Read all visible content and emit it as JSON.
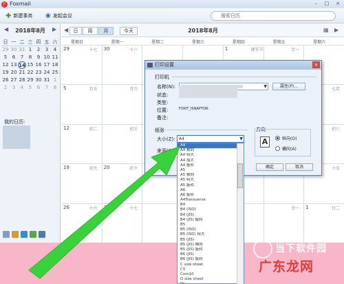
{
  "app": {
    "title": "Foxmail",
    "logo": "F"
  },
  "toolbar": {
    "new_task": "新建事务",
    "meeting": "发起会议"
  },
  "search": {
    "placeholder": "搜索日历"
  },
  "mini_calendar": {
    "title": "2018年8月",
    "weekdays": [
      "日",
      "一",
      "二",
      "三",
      "四",
      "五",
      "六"
    ],
    "days": [
      [
        "29",
        "30",
        "31",
        "1",
        "2",
        "3",
        "4"
      ],
      [
        "5",
        "6",
        "7",
        "8",
        "9",
        "10",
        "11"
      ],
      [
        "12",
        "13",
        "14",
        "15",
        "16",
        "17",
        "18"
      ],
      [
        "19",
        "20",
        "21",
        "22",
        "23",
        "24",
        "25"
      ],
      [
        "26",
        "27",
        "28",
        "29",
        "30",
        "31",
        "1"
      ],
      [
        "2",
        "3",
        "4",
        "5",
        "6",
        "7",
        "8"
      ]
    ],
    "today": "14"
  },
  "my_calendar_label": "我的日历:",
  "view": {
    "day": "日",
    "week": "周",
    "month": "月",
    "today": "今天",
    "title": "2018年8月"
  },
  "weekdays_full": [
    "星期日",
    "星期一",
    "星期二",
    "星期三",
    "星期四",
    "星期五",
    "星期六"
  ],
  "grid": [
    [
      {
        "d": "29",
        "l": "十七"
      },
      {
        "d": "30",
        "l": "十八"
      },
      {
        "d": "",
        "l": ""
      },
      {
        "d": "",
        "l": ""
      },
      {
        "d": "1",
        "l": "建军节"
      },
      {
        "d": "",
        "l": "廿一"
      },
      {
        "d": "",
        "l": ""
      }
    ],
    [
      {
        "d": "5",
        "l": "廿五"
      },
      {
        "d": "",
        "l": "廿六"
      },
      {
        "d": "",
        "l": ""
      },
      {
        "d": "",
        "l": ""
      },
      {
        "d": "",
        "l": ""
      },
      {
        "d": "",
        "l": "廿九"
      },
      {
        "d": "",
        "l": "七月"
      }
    ],
    [
      {
        "d": "12",
        "l": "初二"
      },
      {
        "d": "",
        "l": "初三"
      },
      {
        "d": "",
        "l": ""
      },
      {
        "d": "",
        "l": ""
      },
      {
        "d": "",
        "l": ""
      },
      {
        "d": "",
        "l": "初七"
      },
      {
        "d": "",
        "l": "初八"
      }
    ],
    [
      {
        "d": "19",
        "l": "初九"
      },
      {
        "d": "20",
        "l": "初十"
      },
      {
        "d": "",
        "l": ""
      },
      {
        "d": "",
        "l": ""
      },
      {
        "d": "",
        "l": ""
      },
      {
        "d": "",
        "l": "十四"
      },
      {
        "d": "25",
        "l": "十五"
      }
    ],
    [
      {
        "d": "26",
        "l": "十六"
      },
      {
        "d": "27",
        "l": "十七"
      },
      {
        "d": "",
        "l": ""
      },
      {
        "d": "",
        "l": ""
      },
      {
        "d": "",
        "l": ""
      },
      {
        "d": "",
        "l": "廿一"
      },
      {
        "d": "1",
        "l": "廿二"
      }
    ]
  ],
  "dialog": {
    "title": "打印设置",
    "printer_group": "打印机",
    "name_label": "名称(N):",
    "properties_button": "属性(P)...",
    "status_label": "状态:",
    "type_label": "类型:",
    "where_label": "位置:",
    "where_value": "FOXIT_ISNAPTOR:",
    "comment_label": "备注:",
    "paper_group": "纸张",
    "size_label": "大小(Z):",
    "size_value": "A4",
    "source_label": "来源(S)",
    "orientation_group": "方向",
    "portrait_label": "纵向(O)",
    "landscape_label": "横向(A)",
    "ok_button": "确定",
    "cancel_button": "取消",
    "paper_sizes": [
      "A4",
      "A4 横向",
      "A4 特大",
      "A4 加大",
      "A4 旋转",
      "A5",
      "A5 横向",
      "A5 特大",
      "A5 旋转",
      "A6",
      "A6 旋转",
      "A4Transverse",
      "B4",
      "B4 (ISO)",
      "B4 (JIS)",
      "B4 (JIS) 旋转",
      "B5",
      "B5 (ISO)",
      "B5 (ISO) 特大",
      "B5 (JIS)",
      "B5 (JIS) 横向",
      "B5 (JIS) 旋转",
      "B6 (JIS)",
      "B6 (JIS) 旋转",
      "C size sheet",
      "C5",
      "Com10",
      "D size sheet",
      "DL",
      "DLROD"
    ]
  },
  "watermark": {
    "line1": "当下软件园",
    "line2": "广东龙网"
  },
  "colors": {
    "arrow": "#39d23a",
    "pink_band": "#f7b7c8",
    "watermark_red": "#e03a3a"
  }
}
